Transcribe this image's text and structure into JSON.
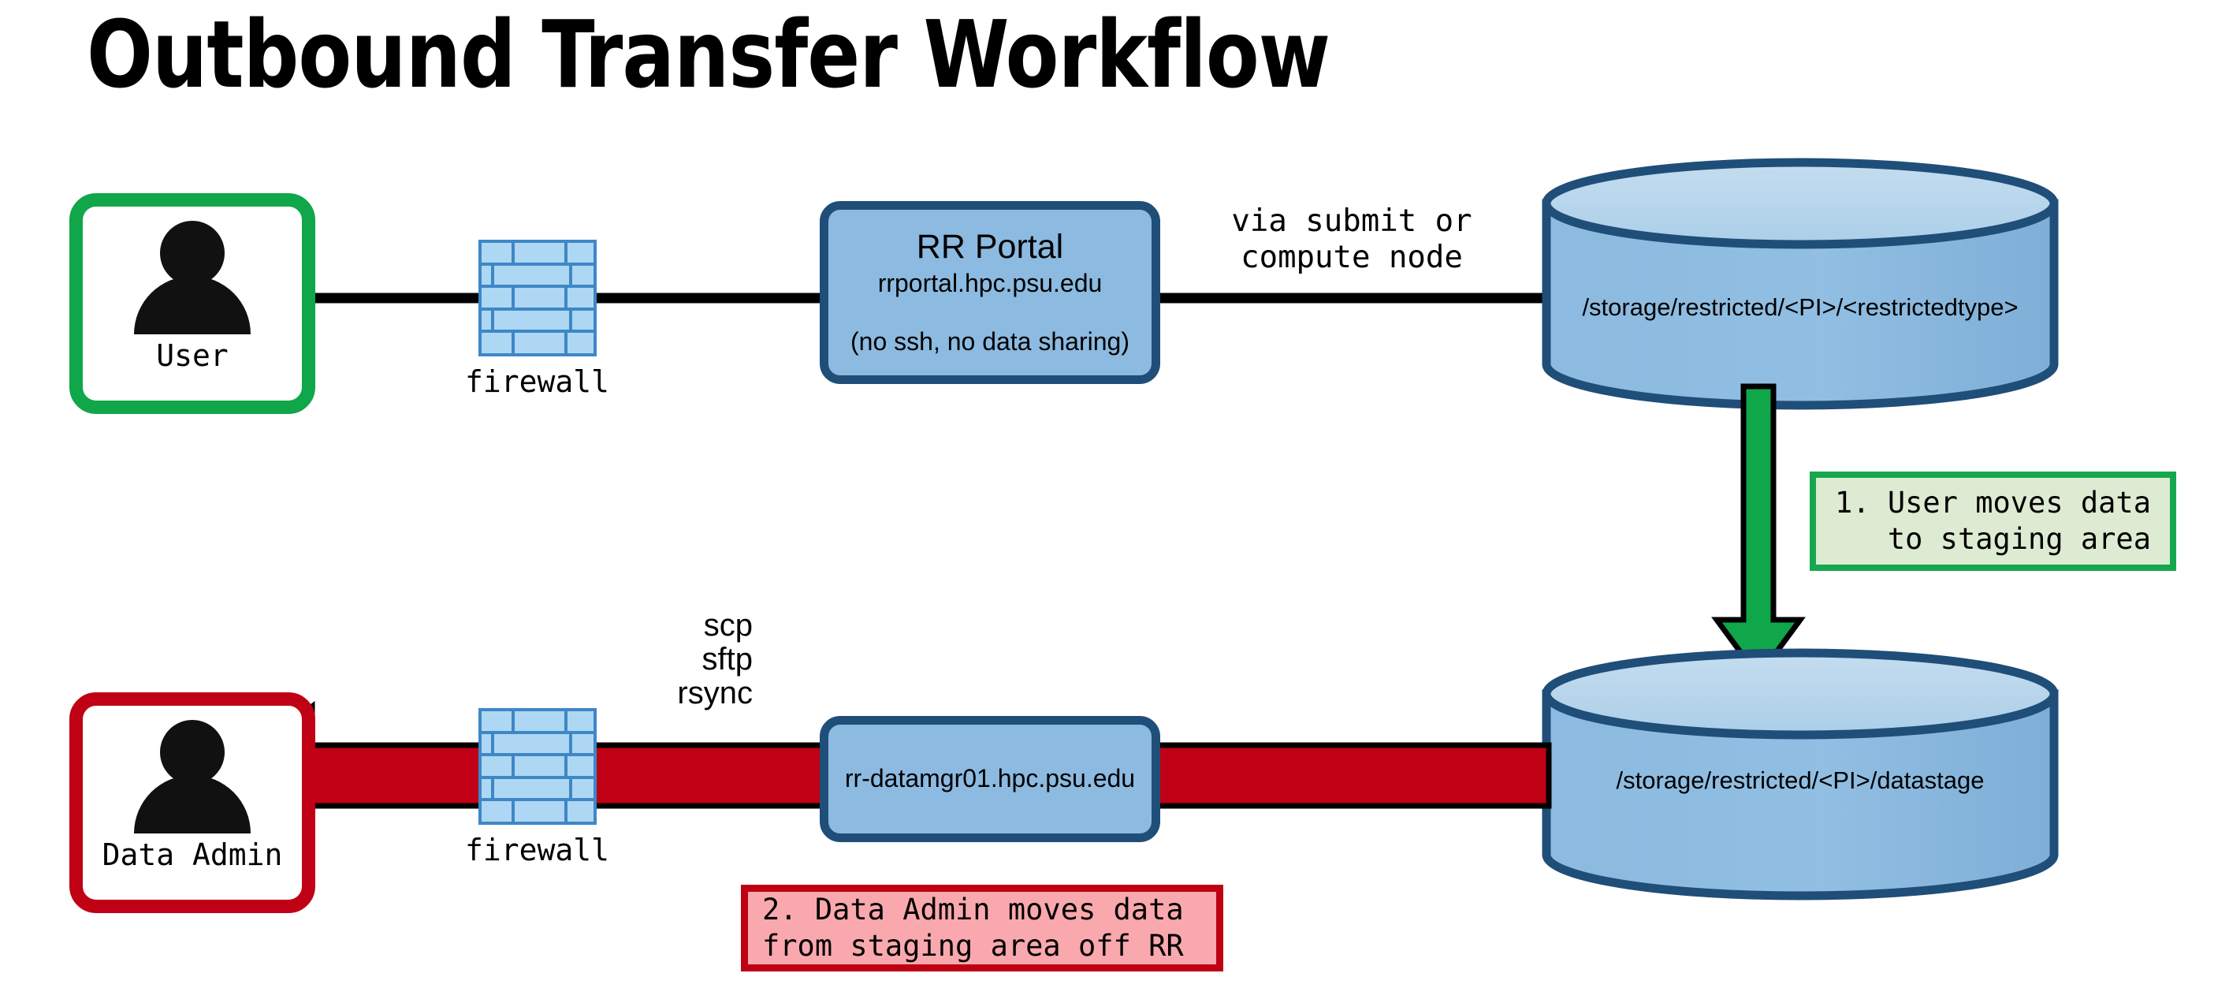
{
  "page": {
    "title": "Outbound Transfer Workflow",
    "background": "#ffffff"
  },
  "colors": {
    "user_border": "#10A64A",
    "admin_border": "#C00014",
    "node_fill": "#8CBAE0",
    "node_border": "#1F4E79",
    "cylinder_fill": "#8CBAE0",
    "cylinder_top": "#B9D6EC",
    "cylinder_border": "#1F4E79",
    "firewall_fill": "#AED7F4",
    "firewall_border": "#3E87C6",
    "green_arrow": "#10A64A",
    "red_arrow": "#C00014",
    "callout_green_fill": "#DDEBD2",
    "callout_green_border": "#16A74E",
    "callout_red_fill": "#F9A8AE",
    "callout_red_border": "#BE0113",
    "line": "#000000"
  },
  "actors": {
    "user": {
      "label": "User",
      "icon": "person-icon"
    },
    "data_admin": {
      "label": "Data Admin",
      "icon": "person-icon"
    }
  },
  "firewalls": [
    {
      "label": "firewall",
      "icon": "brick-wall-icon"
    },
    {
      "label": "firewall",
      "icon": "brick-wall-icon"
    }
  ],
  "nodes": {
    "rr_portal": {
      "title": "RR Portal",
      "host": "rrportal.hpc.psu.edu",
      "note": "(no ssh, no data sharing)"
    },
    "datamgr": {
      "host": "rr-datamgr01.hpc.psu.edu"
    }
  },
  "storage": {
    "restricted": {
      "label": "/storage/restricted/<PI>/<restrictedtype>",
      "icon": "database-cylinder-icon"
    },
    "datastage": {
      "label": "/storage/restricted/<PI>/datastage",
      "icon": "database-cylinder-icon"
    }
  },
  "edges": {
    "via_node": "via submit or\ncompute node",
    "protocols": "scp\nsftp\nrsync"
  },
  "callouts": {
    "step1": "1. User moves data\n   to staging area",
    "step2": "2. Data Admin moves data\nfrom staging area off RR"
  }
}
